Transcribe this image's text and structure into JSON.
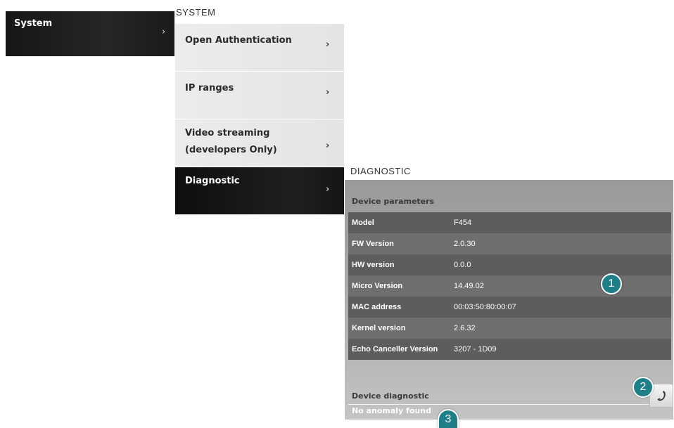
{
  "left_block": {
    "label": "System",
    "chevron": "›"
  },
  "system_menu": {
    "heading": "SYSTEM",
    "items": [
      {
        "label": "Open Authentication",
        "chevron": "›"
      },
      {
        "label": "IP ranges",
        "chevron": "›"
      },
      {
        "label_line1": "Video streaming",
        "label_line2": "(developers Only)",
        "chevron": "›"
      },
      {
        "label": "Diagnostic",
        "chevron": "›",
        "active": true
      }
    ]
  },
  "diagnostic": {
    "heading": "DIAGNOSTIC",
    "device_parameters_label": "Device parameters",
    "parameters": [
      {
        "key": "Model",
        "value": "F454"
      },
      {
        "key": "FW Version",
        "value": "2.0.30"
      },
      {
        "key": "HW version",
        "value": "0.0.0"
      },
      {
        "key": "Micro Version",
        "value": "14.49.02"
      },
      {
        "key": "MAC address",
        "value": "00:03:50:80:00:07"
      },
      {
        "key": "Kernel version",
        "value": "2.6.32"
      },
      {
        "key": "Echo Canceller Version",
        "value": "3207 - 1D09"
      }
    ],
    "device_diagnostic_label": "Device diagnostic",
    "status": "No anomaly found",
    "action_icon": "phone-icon"
  },
  "callouts": [
    "1",
    "2",
    "3"
  ],
  "colors": {
    "callout": "#1e7f89",
    "active_menu": "#111111"
  }
}
